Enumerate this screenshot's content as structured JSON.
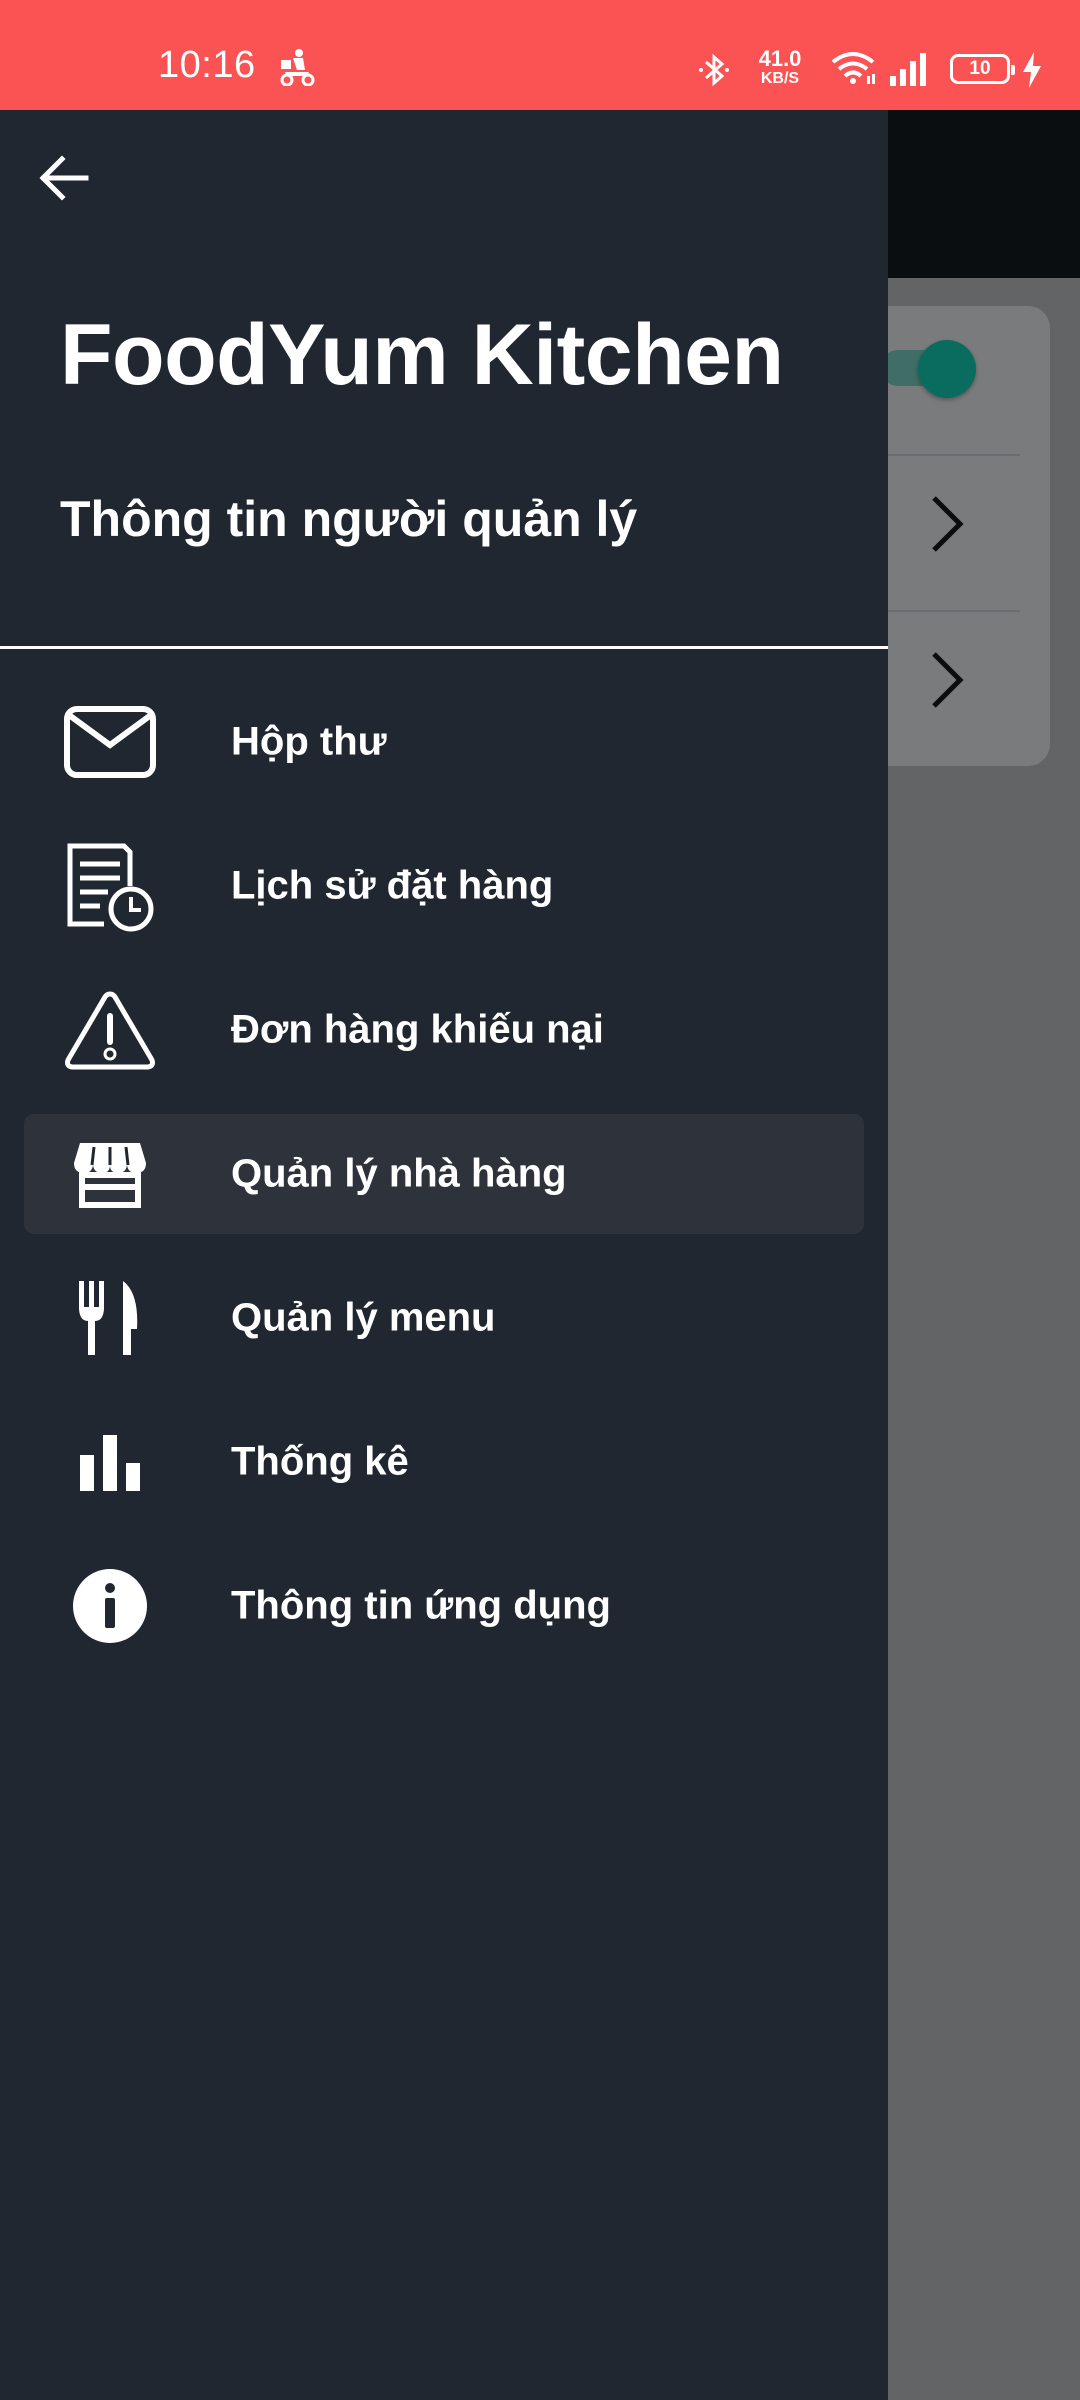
{
  "status_bar": {
    "time": "10:16",
    "network_speed_value": "41.0",
    "network_speed_unit": "KB/S",
    "battery_level": "10",
    "background_color": "#fb5353"
  },
  "drawer": {
    "title": "FoodYum Kitchen",
    "subtitle": "Thông tin người quản lý",
    "background_color": "#212730",
    "active_item_color": "#2d323b",
    "items": [
      {
        "label": "Hộp thư",
        "icon": "mail-icon",
        "active": false
      },
      {
        "label": "Lịch sử đặt hàng",
        "icon": "order-history-icon",
        "active": false
      },
      {
        "label": "Đơn hàng khiếu nại",
        "icon": "warning-icon",
        "active": false
      },
      {
        "label": "Quản lý nhà hàng",
        "icon": "store-icon",
        "active": true
      },
      {
        "label": "Quản lý menu",
        "icon": "fork-knife-icon",
        "active": false
      },
      {
        "label": "Thống kê",
        "icon": "bar-chart-icon",
        "active": false
      },
      {
        "label": "Thông tin ứng dụng",
        "icon": "info-icon",
        "active": false
      }
    ]
  },
  "background": {
    "toggle_on": true,
    "accent_color": "#0a6b5f"
  }
}
